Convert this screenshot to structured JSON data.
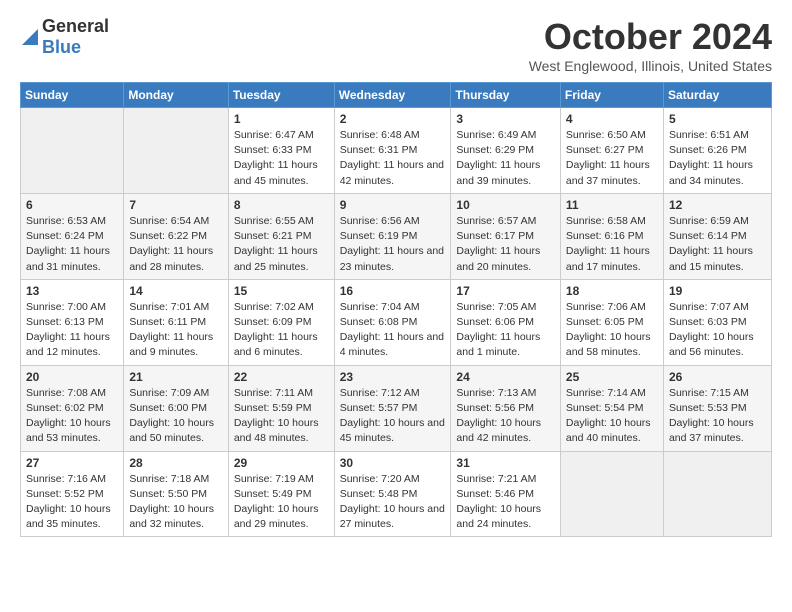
{
  "header": {
    "logo_general": "General",
    "logo_blue": "Blue",
    "month_title": "October 2024",
    "location": "West Englewood, Illinois, United States"
  },
  "weekdays": [
    "Sunday",
    "Monday",
    "Tuesday",
    "Wednesday",
    "Thursday",
    "Friday",
    "Saturday"
  ],
  "weeks": [
    [
      {
        "day": "",
        "empty": true
      },
      {
        "day": "",
        "empty": true
      },
      {
        "day": "1",
        "sunrise": "Sunrise: 6:47 AM",
        "sunset": "Sunset: 6:33 PM",
        "daylight": "Daylight: 11 hours and 45 minutes."
      },
      {
        "day": "2",
        "sunrise": "Sunrise: 6:48 AM",
        "sunset": "Sunset: 6:31 PM",
        "daylight": "Daylight: 11 hours and 42 minutes."
      },
      {
        "day": "3",
        "sunrise": "Sunrise: 6:49 AM",
        "sunset": "Sunset: 6:29 PM",
        "daylight": "Daylight: 11 hours and 39 minutes."
      },
      {
        "day": "4",
        "sunrise": "Sunrise: 6:50 AM",
        "sunset": "Sunset: 6:27 PM",
        "daylight": "Daylight: 11 hours and 37 minutes."
      },
      {
        "day": "5",
        "sunrise": "Sunrise: 6:51 AM",
        "sunset": "Sunset: 6:26 PM",
        "daylight": "Daylight: 11 hours and 34 minutes."
      }
    ],
    [
      {
        "day": "6",
        "sunrise": "Sunrise: 6:53 AM",
        "sunset": "Sunset: 6:24 PM",
        "daylight": "Daylight: 11 hours and 31 minutes."
      },
      {
        "day": "7",
        "sunrise": "Sunrise: 6:54 AM",
        "sunset": "Sunset: 6:22 PM",
        "daylight": "Daylight: 11 hours and 28 minutes."
      },
      {
        "day": "8",
        "sunrise": "Sunrise: 6:55 AM",
        "sunset": "Sunset: 6:21 PM",
        "daylight": "Daylight: 11 hours and 25 minutes."
      },
      {
        "day": "9",
        "sunrise": "Sunrise: 6:56 AM",
        "sunset": "Sunset: 6:19 PM",
        "daylight": "Daylight: 11 hours and 23 minutes."
      },
      {
        "day": "10",
        "sunrise": "Sunrise: 6:57 AM",
        "sunset": "Sunset: 6:17 PM",
        "daylight": "Daylight: 11 hours and 20 minutes."
      },
      {
        "day": "11",
        "sunrise": "Sunrise: 6:58 AM",
        "sunset": "Sunset: 6:16 PM",
        "daylight": "Daylight: 11 hours and 17 minutes."
      },
      {
        "day": "12",
        "sunrise": "Sunrise: 6:59 AM",
        "sunset": "Sunset: 6:14 PM",
        "daylight": "Daylight: 11 hours and 15 minutes."
      }
    ],
    [
      {
        "day": "13",
        "sunrise": "Sunrise: 7:00 AM",
        "sunset": "Sunset: 6:13 PM",
        "daylight": "Daylight: 11 hours and 12 minutes."
      },
      {
        "day": "14",
        "sunrise": "Sunrise: 7:01 AM",
        "sunset": "Sunset: 6:11 PM",
        "daylight": "Daylight: 11 hours and 9 minutes."
      },
      {
        "day": "15",
        "sunrise": "Sunrise: 7:02 AM",
        "sunset": "Sunset: 6:09 PM",
        "daylight": "Daylight: 11 hours and 6 minutes."
      },
      {
        "day": "16",
        "sunrise": "Sunrise: 7:04 AM",
        "sunset": "Sunset: 6:08 PM",
        "daylight": "Daylight: 11 hours and 4 minutes."
      },
      {
        "day": "17",
        "sunrise": "Sunrise: 7:05 AM",
        "sunset": "Sunset: 6:06 PM",
        "daylight": "Daylight: 11 hours and 1 minute."
      },
      {
        "day": "18",
        "sunrise": "Sunrise: 7:06 AM",
        "sunset": "Sunset: 6:05 PM",
        "daylight": "Daylight: 10 hours and 58 minutes."
      },
      {
        "day": "19",
        "sunrise": "Sunrise: 7:07 AM",
        "sunset": "Sunset: 6:03 PM",
        "daylight": "Daylight: 10 hours and 56 minutes."
      }
    ],
    [
      {
        "day": "20",
        "sunrise": "Sunrise: 7:08 AM",
        "sunset": "Sunset: 6:02 PM",
        "daylight": "Daylight: 10 hours and 53 minutes."
      },
      {
        "day": "21",
        "sunrise": "Sunrise: 7:09 AM",
        "sunset": "Sunset: 6:00 PM",
        "daylight": "Daylight: 10 hours and 50 minutes."
      },
      {
        "day": "22",
        "sunrise": "Sunrise: 7:11 AM",
        "sunset": "Sunset: 5:59 PM",
        "daylight": "Daylight: 10 hours and 48 minutes."
      },
      {
        "day": "23",
        "sunrise": "Sunrise: 7:12 AM",
        "sunset": "Sunset: 5:57 PM",
        "daylight": "Daylight: 10 hours and 45 minutes."
      },
      {
        "day": "24",
        "sunrise": "Sunrise: 7:13 AM",
        "sunset": "Sunset: 5:56 PM",
        "daylight": "Daylight: 10 hours and 42 minutes."
      },
      {
        "day": "25",
        "sunrise": "Sunrise: 7:14 AM",
        "sunset": "Sunset: 5:54 PM",
        "daylight": "Daylight: 10 hours and 40 minutes."
      },
      {
        "day": "26",
        "sunrise": "Sunrise: 7:15 AM",
        "sunset": "Sunset: 5:53 PM",
        "daylight": "Daylight: 10 hours and 37 minutes."
      }
    ],
    [
      {
        "day": "27",
        "sunrise": "Sunrise: 7:16 AM",
        "sunset": "Sunset: 5:52 PM",
        "daylight": "Daylight: 10 hours and 35 minutes."
      },
      {
        "day": "28",
        "sunrise": "Sunrise: 7:18 AM",
        "sunset": "Sunset: 5:50 PM",
        "daylight": "Daylight: 10 hours and 32 minutes."
      },
      {
        "day": "29",
        "sunrise": "Sunrise: 7:19 AM",
        "sunset": "Sunset: 5:49 PM",
        "daylight": "Daylight: 10 hours and 29 minutes."
      },
      {
        "day": "30",
        "sunrise": "Sunrise: 7:20 AM",
        "sunset": "Sunset: 5:48 PM",
        "daylight": "Daylight: 10 hours and 27 minutes."
      },
      {
        "day": "31",
        "sunrise": "Sunrise: 7:21 AM",
        "sunset": "Sunset: 5:46 PM",
        "daylight": "Daylight: 10 hours and 24 minutes."
      },
      {
        "day": "",
        "empty": true
      },
      {
        "day": "",
        "empty": true
      }
    ]
  ]
}
